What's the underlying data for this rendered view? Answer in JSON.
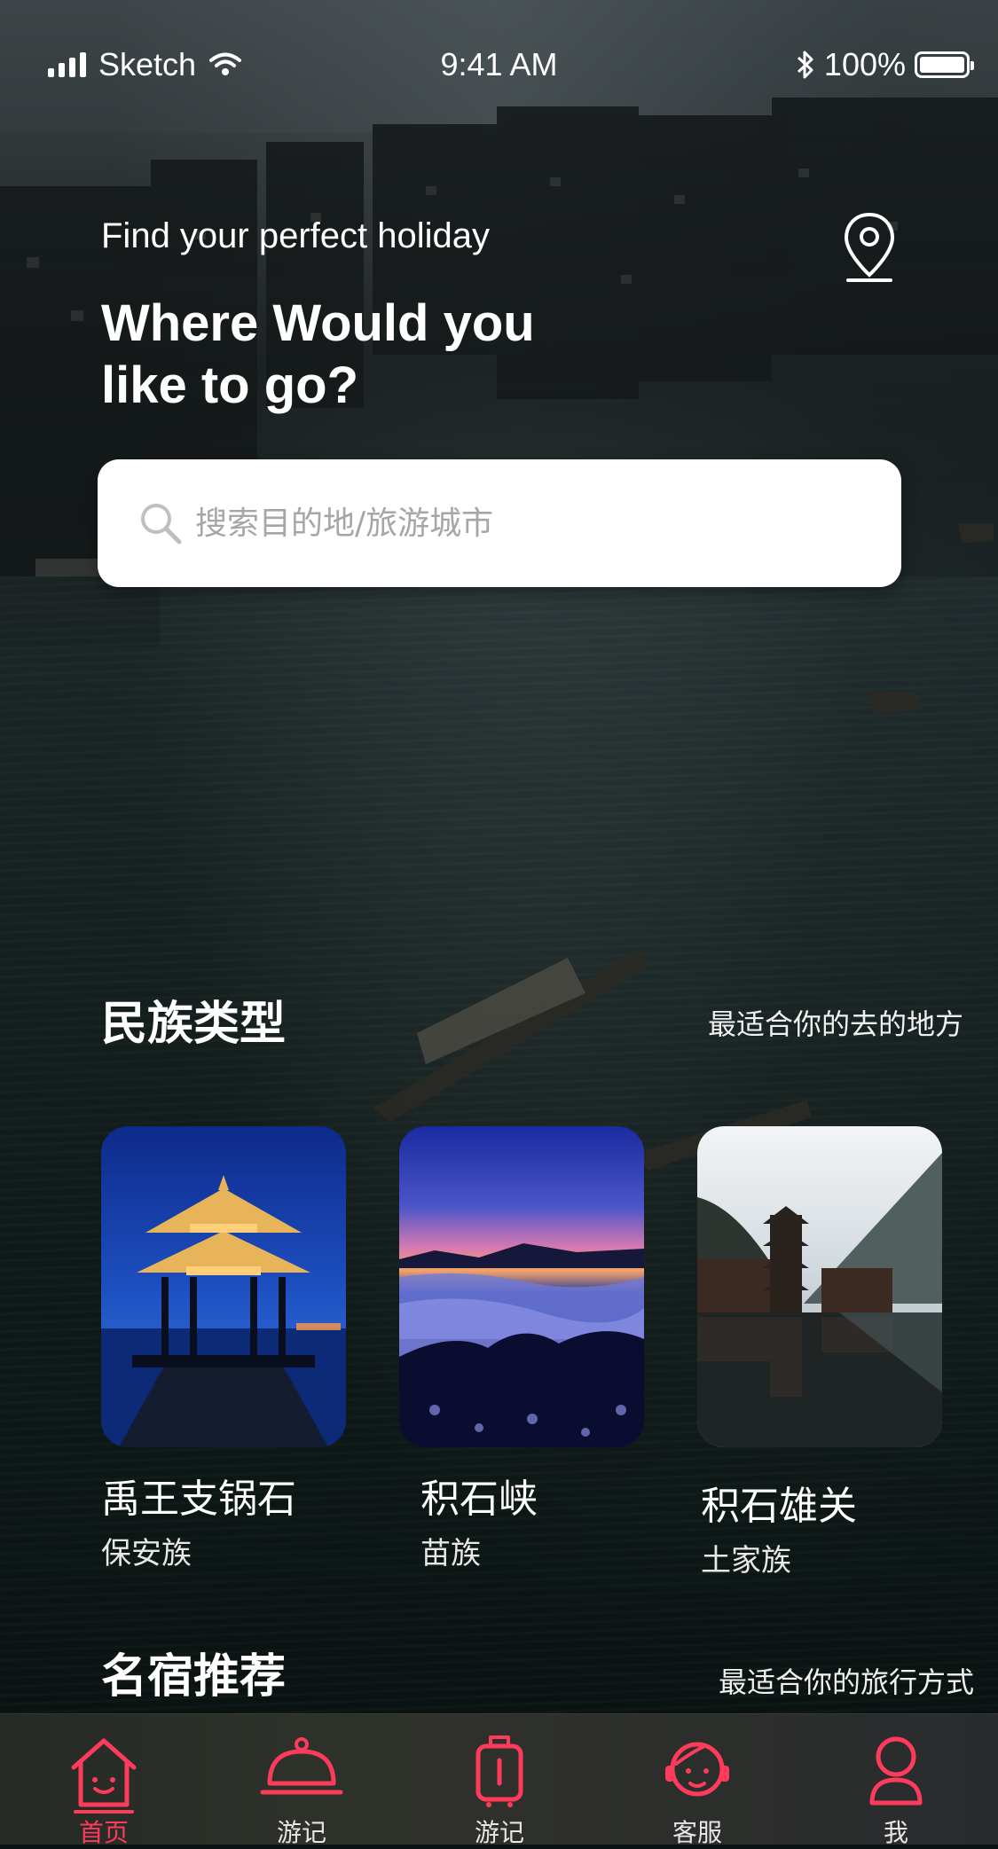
{
  "status_bar": {
    "carrier": "Sketch",
    "time": "9:41 AM",
    "battery": "100%",
    "battery_level": 1.0
  },
  "hero": {
    "subtitle": "Find your perfect holiday",
    "title_line1": "Where Would you",
    "title_line2": "like to go?"
  },
  "search": {
    "placeholder": "搜索目的地/旅游城市",
    "value": ""
  },
  "sections": {
    "ethnic": {
      "title": "民族类型",
      "more": "最适合你的去的地方"
    },
    "homestay": {
      "title": "名宿推荐",
      "more": "最适合你的旅行方式"
    }
  },
  "cards": [
    {
      "name": "禹王支锅石",
      "ethnic": "保安族",
      "image": "pavilion-night"
    },
    {
      "name": "积石峡",
      "ethnic": "苗族",
      "image": "sea-of-clouds"
    },
    {
      "name": "积石雄关",
      "ethnic": "土家族",
      "image": "riverside-pagoda"
    }
  ],
  "tabs": [
    {
      "label": "首页",
      "icon": "home-icon",
      "active": true
    },
    {
      "label": "游记",
      "icon": "cloche-icon",
      "active": false
    },
    {
      "label": "游记",
      "icon": "luggage-icon",
      "active": false
    },
    {
      "label": "客服",
      "icon": "support-icon",
      "active": false
    },
    {
      "label": "我",
      "icon": "user-icon",
      "active": false
    }
  ],
  "colors": {
    "accent": "#ff3b5c",
    "search_bg": "#ffffff",
    "tab_bar_bg": "#2c2e2a"
  }
}
